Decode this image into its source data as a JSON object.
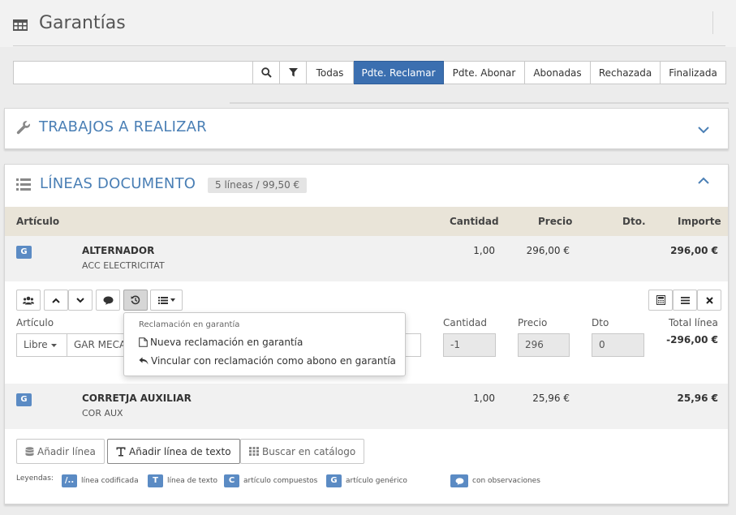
{
  "header": {
    "title": "Garantías",
    "icon": "table-icon"
  },
  "filter": {
    "search_value": "",
    "tabs": [
      {
        "label": "Todas"
      },
      {
        "label": "Pdte. Reclamar"
      },
      {
        "label": "Pdte. Abonar"
      },
      {
        "label": "Abonadas"
      },
      {
        "label": "Rechazada"
      },
      {
        "label": "Finalizada"
      }
    ],
    "active_tab": "Pdte. Reclamar",
    "active_color": "#3b6fb0"
  },
  "trabajos": {
    "title": "TRABAJOS A REALIZAR",
    "icon": "wrench-icon"
  },
  "lineas": {
    "title": "LÍNEAS DOCUMENTO",
    "count_badge": "5 líneas / 99,50 €",
    "columns": {
      "articulo": "Artículo",
      "cantidad": "Cantidad",
      "precio": "Precio",
      "dto": "Dto.",
      "importe": "Importe"
    },
    "rows": [
      {
        "badge": "G",
        "name": "ALTERNADOR",
        "sub": "ACC ELECTRICITAT",
        "cantidad": "1,00",
        "precio": "296,00 €",
        "importe": "296,00 €"
      },
      {
        "badge": "G",
        "name": "CORRETJA AUXILIAR",
        "sub": "COR AUX",
        "cantidad": "1,00",
        "precio": "25,96 €",
        "importe": "25,96 €"
      }
    ],
    "edit": {
      "labels": {
        "articulo": "Artículo",
        "cantidad": "Cantidad",
        "precio": "Precio",
        "dto": "Dto",
        "total": "Total línea"
      },
      "tipo": "Libre",
      "articulo_value": "GAR MECA",
      "cantidad": "-1",
      "precio": "296",
      "dto": "0",
      "total": "-296,00 €"
    }
  },
  "dropdown": {
    "header": "Reclamación en garantía",
    "items": [
      {
        "label": "Nueva reclamación en garantía",
        "icon": "file-icon"
      },
      {
        "label": "Vincular con reclamación como abono en garantía",
        "icon": "reply-icon"
      }
    ]
  },
  "actions": {
    "add_line": "Añadir línea",
    "add_text_line": "Añadir línea de texto",
    "search_catalog": "Buscar en catálogo"
  },
  "legend": {
    "label": "Leyendas:",
    "items": [
      {
        "badge": "/..",
        "text": "línea codificada"
      },
      {
        "badge": "T",
        "text": "línea de texto"
      },
      {
        "badge": "C",
        "text": "artículo compuestos"
      },
      {
        "badge": "G",
        "text": "artículo genérico"
      },
      {
        "badge": "",
        "text": "con observaciones"
      }
    ]
  }
}
